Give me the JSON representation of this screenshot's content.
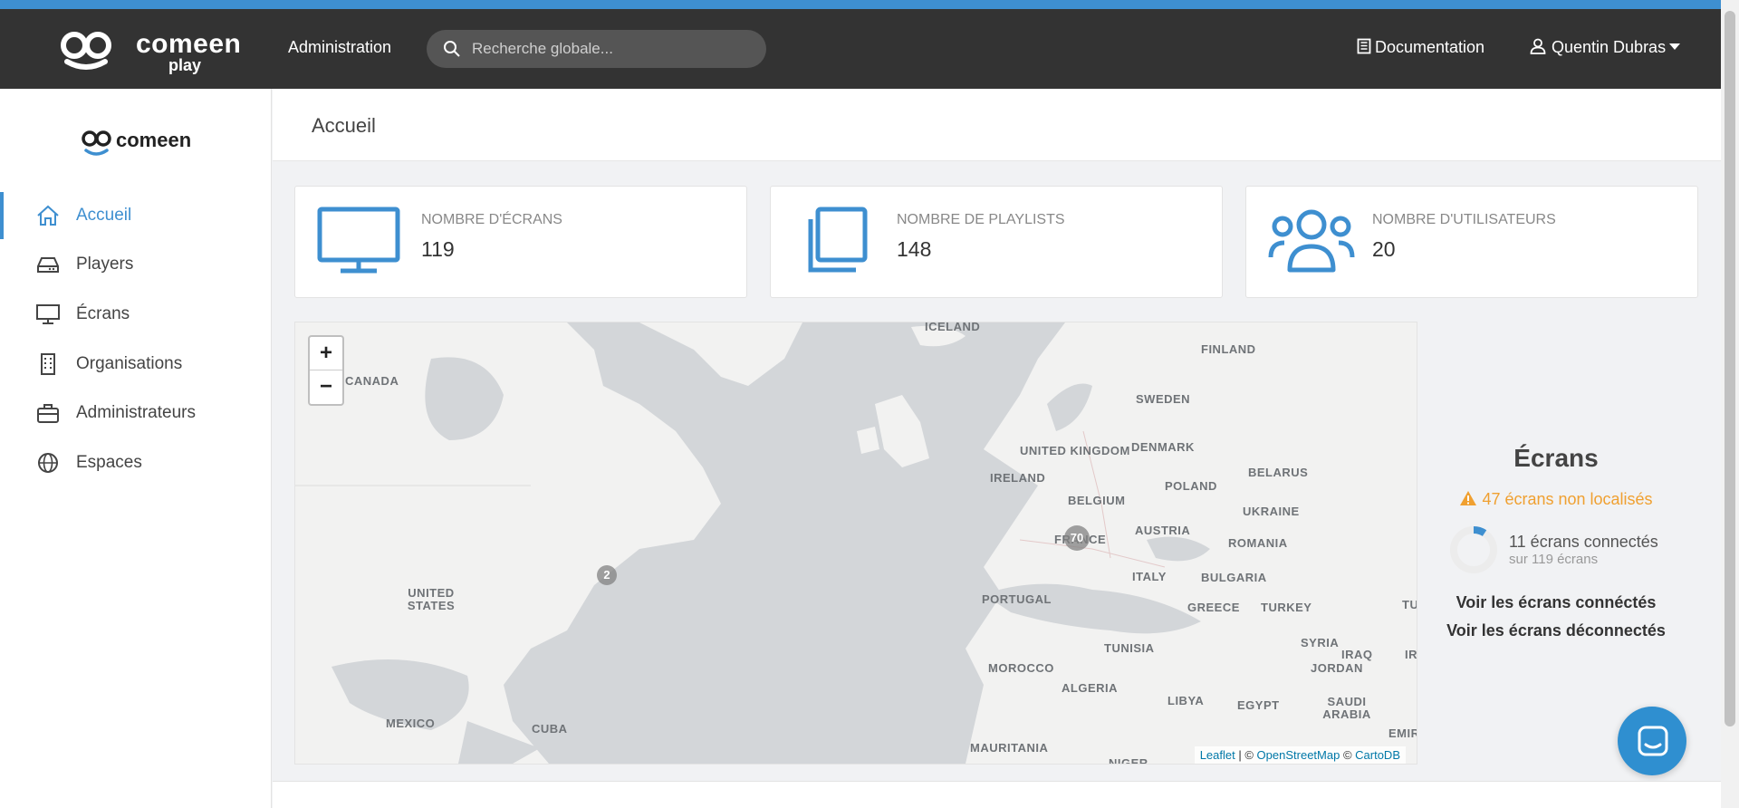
{
  "topbar": {
    "brand": "comeen",
    "brand_sub": "play",
    "admin_label": "Administration",
    "search_placeholder": "Recherche globale...",
    "doc_label": "Documentation",
    "user_label": "Quentin Dubras"
  },
  "sidebar": {
    "brand": "comeen",
    "items": [
      {
        "label": "Accueil",
        "icon": "home-icon",
        "active": true
      },
      {
        "label": "Players",
        "icon": "hard-drive-icon"
      },
      {
        "label": "Écrans",
        "icon": "monitor-icon"
      },
      {
        "label": "Organisations",
        "icon": "building-icon"
      },
      {
        "label": "Administrateurs",
        "icon": "briefcase-icon"
      },
      {
        "label": "Espaces",
        "icon": "globe-icon"
      }
    ]
  },
  "page": {
    "title": "Accueil"
  },
  "cards": [
    {
      "label": "NOMBRE D'ÉCRANS",
      "value": "119",
      "icon": "monitor-icon"
    },
    {
      "label": "NOMBRE DE PLAYLISTS",
      "value": "148",
      "icon": "copy-icon"
    },
    {
      "label": "NOMBRE D'UTILISATEURS",
      "value": "20",
      "icon": "users-icon"
    }
  ],
  "map": {
    "countries": [
      "ICELAND",
      "FINLAND",
      "CANADA",
      "SWEDEN",
      "UNITED KINGDOM",
      "DENMARK",
      "IRELAND",
      "BELARUS",
      "POLAND",
      "BELGIUM",
      "UKRAINE",
      "FRANCE",
      "AUSTRIA",
      "ROMANIA",
      "ITALY",
      "BULGARIA",
      "UNITED STATES",
      "PORTUGAL",
      "GREECE",
      "TURKEY",
      "TU",
      "SYRIA",
      "TUNISIA",
      "IRAQ",
      "MOROCCO",
      "JORDAN",
      "ALGERIA",
      "LIBYA",
      "EGYPT",
      "SAUDI ARABIA",
      "IR",
      "EMIR",
      "MEXICO",
      "CUBA",
      "MAURITANIA",
      "NIGER"
    ],
    "clusters": [
      {
        "count": "70"
      },
      {
        "count": "2"
      }
    ],
    "zoom_in": "+",
    "zoom_out": "−",
    "attribution": {
      "leaflet": "Leaflet",
      "sep1": " | © ",
      "osm": "OpenStreetMap",
      "sep2": " © ",
      "carto": "CartoDB"
    }
  },
  "screens": {
    "title": "Écrans",
    "unlocated": "47 écrans non localisés",
    "connected": "11 écrans connectés",
    "total": "sur 119 écrans",
    "connected_fraction": 0.092,
    "see_connected": "Voir les écrans connéctés",
    "see_disconnected": "Voir les écrans déconnectés"
  },
  "colors": {
    "accent": "#3e8fd0",
    "warning": "#f0a030",
    "topbar": "#333333"
  }
}
